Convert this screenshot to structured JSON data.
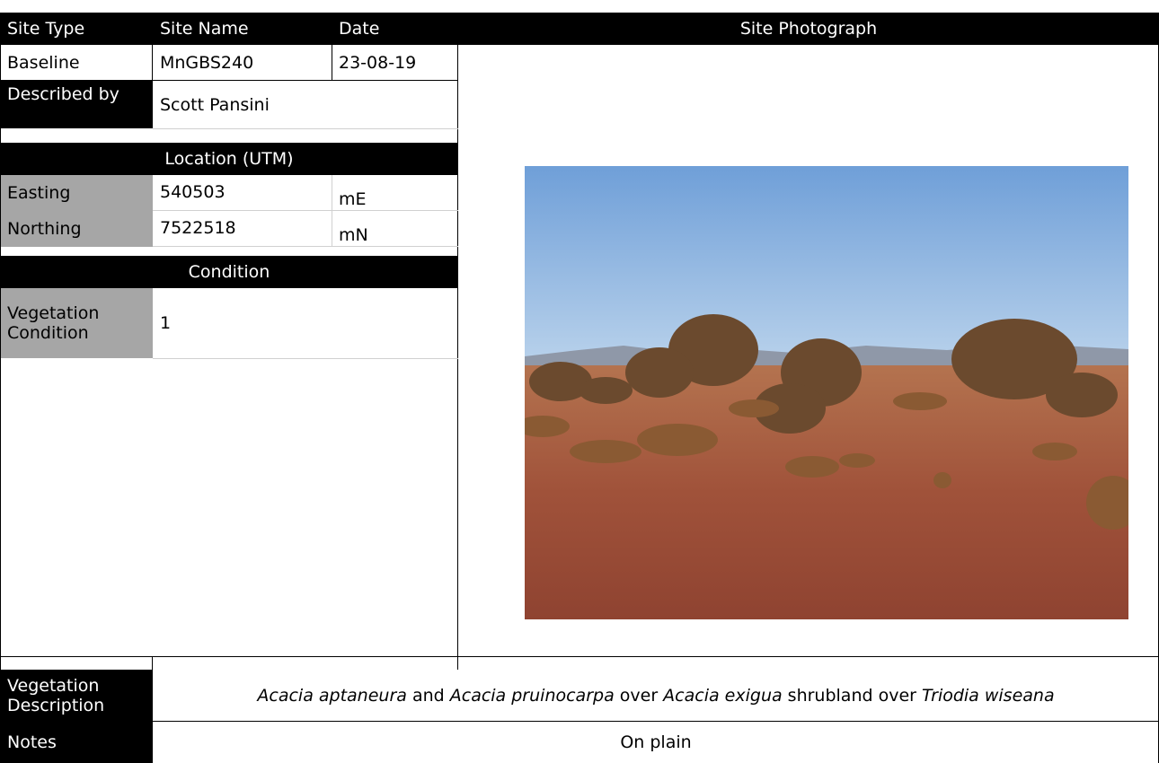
{
  "header": {
    "site_type": "Site Type",
    "site_name": "Site Name",
    "date": "Date",
    "site_photograph": "Site Photograph"
  },
  "site": {
    "type": "Baseline",
    "name": "MnGBS240",
    "date": "23-08-19",
    "described_by_label": "Described by",
    "described_by": "Scott Pansini"
  },
  "location": {
    "title": "Location (UTM)",
    "easting_label": "Easting",
    "easting": "540503",
    "easting_unit": "mE",
    "northing_label": "Northing",
    "northing": "7522518",
    "northing_unit": "mN"
  },
  "condition": {
    "title": "Condition",
    "vegetation_condition_label": "Vegetation Condition",
    "vegetation_condition": "1"
  },
  "vegetation_description": {
    "label": "Vegetation Description",
    "parts": [
      {
        "text": "Acacia aptaneura",
        "italic": true
      },
      {
        "text": " and ",
        "italic": false
      },
      {
        "text": "Acacia pruinocarpa",
        "italic": true
      },
      {
        "text": " over ",
        "italic": false
      },
      {
        "text": "Acacia exigua",
        "italic": true
      },
      {
        "text": " shrubland over ",
        "italic": false
      },
      {
        "text": "Triodia wiseana",
        "italic": true
      }
    ]
  },
  "notes": {
    "label": "Notes",
    "value": "On plain"
  },
  "photo": {
    "sky_top": "#6f9fd8",
    "sky_bottom": "#b9d3ec",
    "ground": "#a0523a",
    "shrub": "#6b4a2e"
  }
}
